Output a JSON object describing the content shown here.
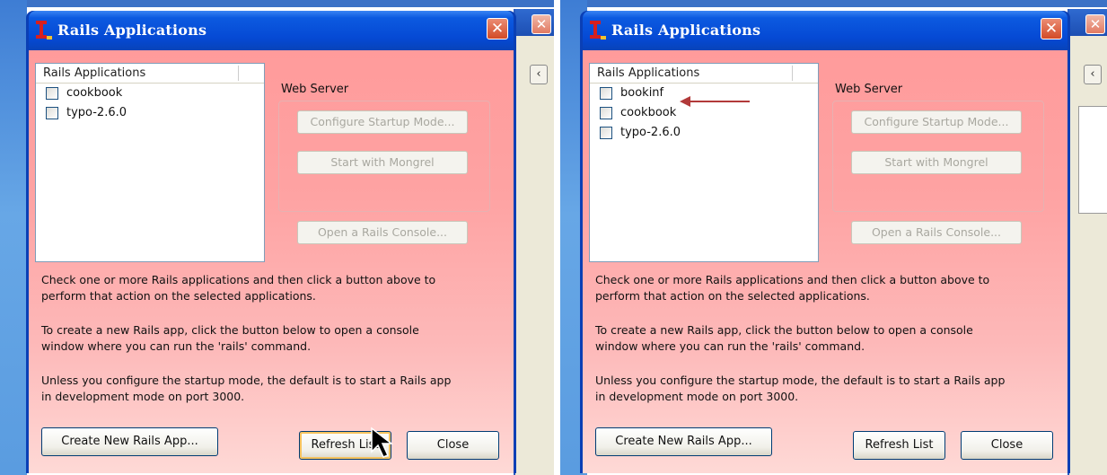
{
  "dialog_title": "Rails Applications",
  "list_header": "Rails Applications",
  "web_server_label": "Web Server",
  "buttons": {
    "configure": "Configure Startup Mode...",
    "mongrel": "Start with Mongrel",
    "console": "Open a Rails Console...",
    "create": "Create New Rails App...",
    "refresh": "Refresh List",
    "close": "Close"
  },
  "messages": {
    "m1a": "Check one or more Rails applications and then click a button above to",
    "m1b": "perform that action on the selected applications.",
    "m2a": "To create a new Rails app, click the button below to open a console",
    "m2b": "window where you can run the 'rails' command.",
    "m3a": "Unless you configure the startup mode, the default is to start a Rails app",
    "m3b": "in development mode on port 3000."
  },
  "left_apps": [
    "cookbook",
    "typo-2.6.0"
  ],
  "right_apps": [
    "bookinf",
    "cookbook",
    "typo-2.6.0"
  ],
  "bg_window": {
    "close_glyph": "✕",
    "back_glyph": "‹"
  },
  "colors": {
    "title_blue": "#0549d4",
    "client_pink": "#fea3a3",
    "highlight_arrow": "#b23a3a"
  }
}
